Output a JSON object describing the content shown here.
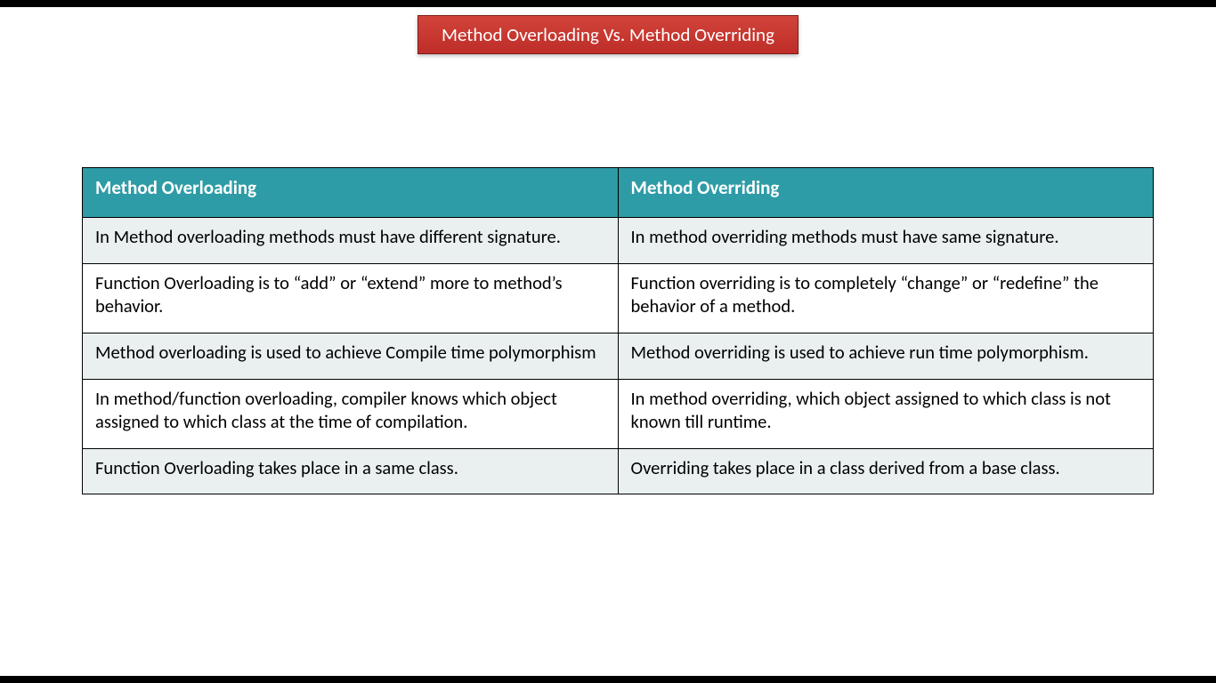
{
  "title": "Method Overloading Vs. Method Overriding",
  "headers": {
    "left": "Method Overloading",
    "right": "Method Overriding"
  },
  "rows": [
    {
      "left": "In Method overloading methods must have different signature.",
      "right": "In method overriding methods must have same signature.",
      "alt": true
    },
    {
      "left": "Function Overloading is to “add” or “extend” more to method’s behavior.",
      "right": "Function overriding is to completely “change” or “redefine” the behavior of a method.",
      "alt": false
    },
    {
      "left": "Method overloading is used to achieve Compile time polymorphism",
      "right": "Method overriding is used to achieve run time polymorphism.",
      "alt": true
    },
    {
      "left": "In method/function overloading, compiler knows which object assigned to which class at the time of compilation.",
      "right": "In method overriding, which object assigned to which class is not known till runtime.",
      "alt": false
    },
    {
      "left": "Function Overloading takes place in a same class.",
      "right": "Overriding takes place in a class derived from a base class.",
      "alt": true
    }
  ]
}
